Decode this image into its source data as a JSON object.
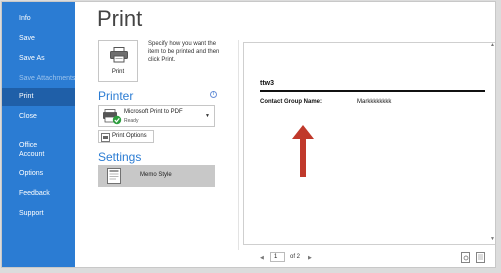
{
  "sidebar": {
    "items": [
      {
        "label": "Info",
        "state": "normal"
      },
      {
        "label": "Save",
        "state": "normal"
      },
      {
        "label": "Save As",
        "state": "normal"
      },
      {
        "label": "Save Attachments",
        "state": "disabled"
      },
      {
        "label": "Print",
        "state": "active"
      },
      {
        "label": "Close",
        "state": "normal"
      },
      {
        "label": "Office Account",
        "state": "normal"
      },
      {
        "label": "Options",
        "state": "normal"
      },
      {
        "label": "Feedback",
        "state": "normal"
      },
      {
        "label": "Support",
        "state": "normal"
      }
    ]
  },
  "main": {
    "title": "Print",
    "print_button_label": "Print",
    "help_text": "Specify how you want the item to be printed and then click Print.",
    "printer_heading": "Printer",
    "info_icon": "i",
    "printer_name": "Microsoft Print to PDF",
    "printer_status": "Ready",
    "print_options_label": "Print Options",
    "settings_heading": "Settings",
    "memo_style_label": "Memo Style"
  },
  "preview": {
    "title": "ttw3",
    "field_label": "Contact Group Name:",
    "field_value": "Markkkkkkkk"
  },
  "pager": {
    "current_page": "1",
    "of_text": "of 2"
  },
  "colors": {
    "sidebar_bg": "#2b7cd3",
    "sidebar_active": "#1f5fa8",
    "accent": "#2b7cd3",
    "arrow": "#c0392b"
  }
}
